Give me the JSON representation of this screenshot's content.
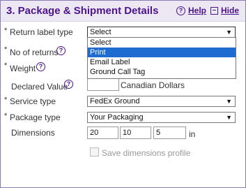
{
  "header": {
    "title": "3. Package & Shipment Details",
    "help_label": "Help",
    "hide_label": "Hide"
  },
  "fields": {
    "required_marker": "*",
    "return_label_type": {
      "label": "Return label type",
      "value": "Select"
    },
    "no_of_returns": {
      "label": "No of returns"
    },
    "weight": {
      "label": "Weight"
    },
    "declared_value": {
      "label": "Declared Value",
      "value": "",
      "unit": "Canadian Dollars"
    },
    "service_type": {
      "label": "Service type",
      "value": "FedEx Ground"
    },
    "package_type": {
      "label": "Package type",
      "value": "Your Packaging"
    },
    "dimensions": {
      "label": "Dimensions",
      "length": "20",
      "width": "10",
      "height": "5",
      "unit": "in"
    },
    "save_dimensions": {
      "label": "Save dimensions profile",
      "checked": false
    }
  },
  "return_label_dropdown": {
    "options": [
      "Select",
      "Print",
      "Email Label",
      "Ground Call Tag"
    ],
    "highlighted": "Print"
  },
  "colors": {
    "brand_purple": "#4d148c",
    "header_bg": "#ebe8f3",
    "highlight_blue": "#1e6bd1"
  }
}
